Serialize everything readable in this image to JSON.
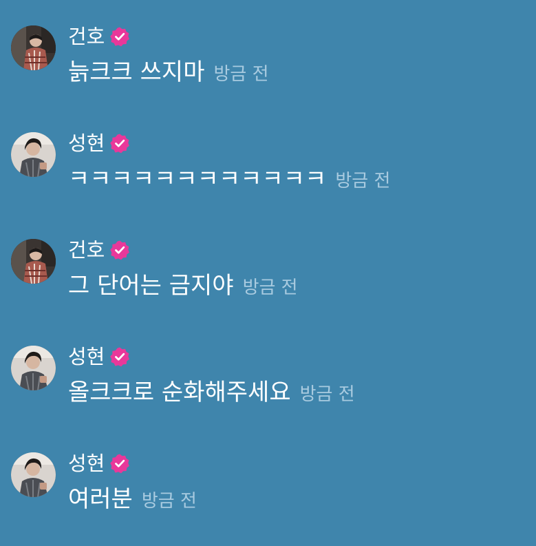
{
  "colors": {
    "background": "#3f85ac",
    "text": "#ffffff",
    "timestamp": "#a9cbe0",
    "verified_badge": "#e9389a"
  },
  "messages": [
    {
      "author": "건호",
      "verified": true,
      "avatar": "user-avatar-geonho",
      "text": "늙크크 쓰지마",
      "time": "방금 전"
    },
    {
      "author": "성현",
      "verified": true,
      "avatar": "user-avatar-seonghyeon",
      "text": "ㅋㅋㅋㅋㅋㅋㅋㅋㅋㅋㅋㅋ",
      "time": "방금 전"
    },
    {
      "author": "건호",
      "verified": true,
      "avatar": "user-avatar-geonho",
      "text": "그 단어는 금지야",
      "time": "방금 전"
    },
    {
      "author": "성현",
      "verified": true,
      "avatar": "user-avatar-seonghyeon",
      "text": "올크크로 순화해주세요",
      "time": "방금 전"
    },
    {
      "author": "성현",
      "verified": true,
      "avatar": "user-avatar-seonghyeon",
      "text": "여러분",
      "time": "방금 전"
    }
  ]
}
